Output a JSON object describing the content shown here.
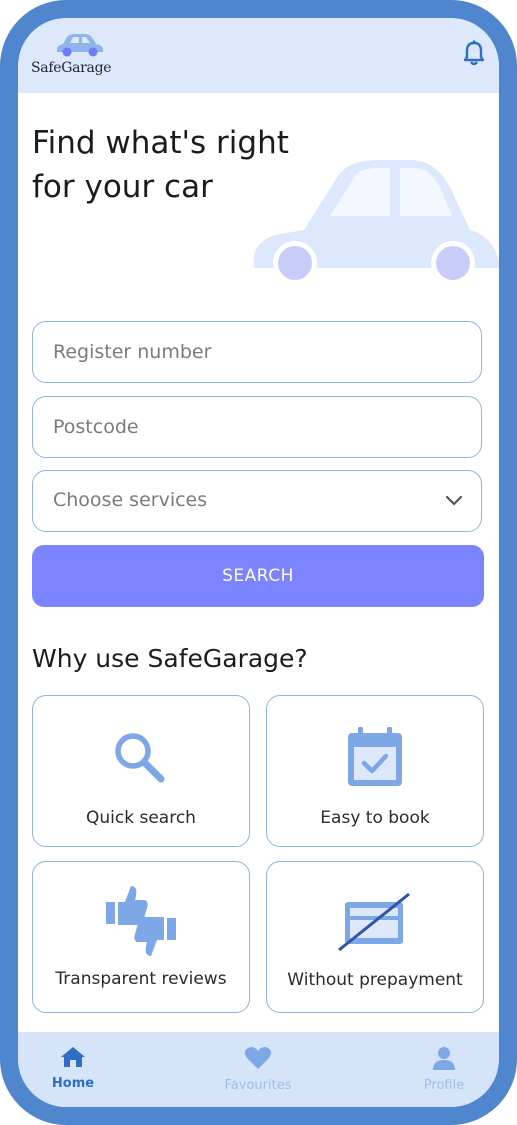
{
  "app": {
    "logo_text": "SafeGarage"
  },
  "header": {
    "logo_icon": "car-icon",
    "bell_icon": "bell-icon"
  },
  "hero": {
    "title_line1": "Find what's right",
    "title_line2": "for your car",
    "illustration": "car-illustration"
  },
  "form": {
    "register_placeholder": "Register number",
    "postcode_placeholder": "Postcode",
    "services_value": "Choose services",
    "search_label": "SEARCH"
  },
  "why": {
    "title": "Why use SafeGarage?",
    "cards": [
      {
        "label": "Quick search",
        "icon": "search-icon"
      },
      {
        "label": "Easy to book",
        "icon": "calendar-check-icon"
      },
      {
        "label": "Transparent reviews",
        "icon": "thumbs-icon"
      },
      {
        "label": "Without prepayment",
        "icon": "no-card-icon"
      }
    ]
  },
  "tabs": [
    {
      "label": "Home",
      "icon": "home-icon",
      "active": true
    },
    {
      "label": "Favourites",
      "icon": "heart-icon",
      "active": false
    },
    {
      "label": "Profile",
      "icon": "profile-icon",
      "active": false
    }
  ],
  "colors": {
    "frame": "#4f86cd",
    "header": "#dde8fb",
    "accent": "#7b83ff",
    "icon": "#7ea7e7",
    "border": "#8cb3ea",
    "tab_active": "#2f6fc3",
    "tab_inactive": "#9fbfe9"
  }
}
